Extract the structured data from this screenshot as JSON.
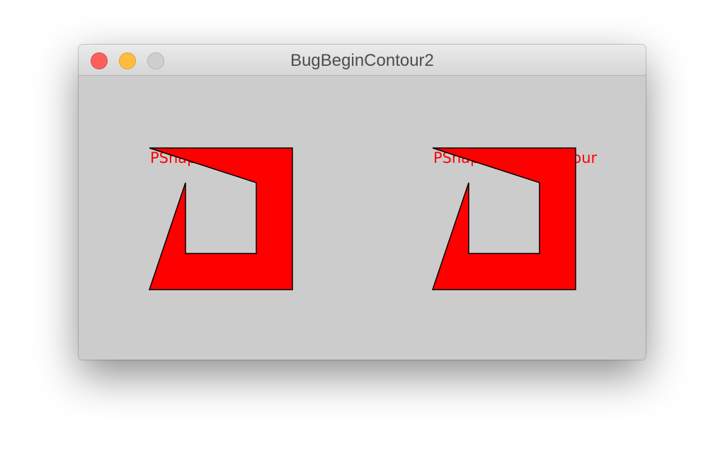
{
  "window": {
    "title": "BugBeginContour2"
  },
  "titlebar": {
    "buttons": [
      "close",
      "minimize",
      "zoom"
    ]
  },
  "sketch": {
    "background_color": "#cccccc",
    "shape_fill_color": "#ff0000",
    "shape_stroke_color": "#000000",
    "label_color": "#ff0000",
    "shapes": [
      {
        "label": "PShape w contour"
      },
      {
        "label": "PShape w/out contour"
      }
    ]
  }
}
